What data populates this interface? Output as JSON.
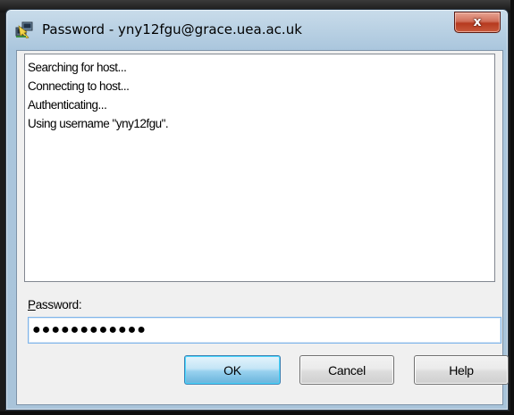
{
  "window": {
    "title": "Password - yny12fgu@grace.uea.ac.uk",
    "app_icon": "putty-icon",
    "close_label": "x"
  },
  "log": {
    "lines": [
      "Searching for host...",
      "Connecting to host...",
      "Authenticating...",
      "Using username \"yny12fgu\"."
    ]
  },
  "password": {
    "label_accel": "P",
    "label_rest": "assword:",
    "masked_value": "●●●●●●●●●●●●"
  },
  "buttons": {
    "ok": "OK",
    "cancel": "Cancel",
    "help": "Help"
  },
  "colors": {
    "title_glass": "#b8d0e3",
    "close_red": "#c85a3c",
    "default_button": "#98d1ef",
    "focus_border": "#7eb4ea"
  }
}
